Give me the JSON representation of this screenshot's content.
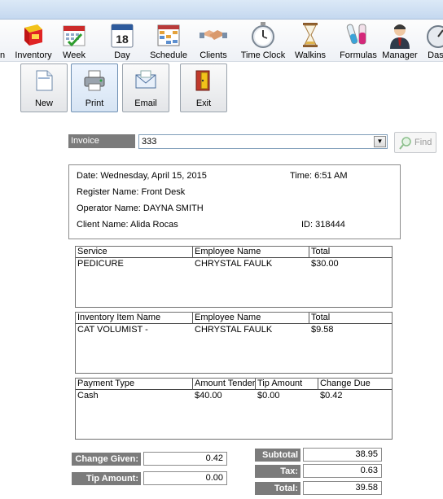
{
  "toolbar": {
    "items": [
      {
        "label": "on",
        "icon": "admin-icon"
      },
      {
        "label": "Inventory",
        "icon": "inventory-box-icon"
      },
      {
        "label": "Week",
        "icon": "week-calendar-icon"
      },
      {
        "label": "Day",
        "icon": "day-calendar-icon"
      },
      {
        "label": "Schedule",
        "icon": "schedule-grid-icon"
      },
      {
        "label": "Clients",
        "icon": "handshake-icon"
      },
      {
        "label": "Time Clock",
        "icon": "stopwatch-icon"
      },
      {
        "label": "Walkins",
        "icon": "hourglass-icon"
      },
      {
        "label": "Formulas",
        "icon": "test-tubes-icon"
      },
      {
        "label": "Manager",
        "icon": "manager-person-icon"
      },
      {
        "label": "Dash",
        "icon": "dashboard-gauge-icon"
      }
    ],
    "day_number": "18"
  },
  "actions": {
    "new": "New",
    "print": "Print",
    "email": "Email",
    "exit": "Exit"
  },
  "invoice": {
    "label": "Invoice Number:",
    "value": "333",
    "find": "Find"
  },
  "info": {
    "date": "Date:  Wednesday, April 15, 2015",
    "time": "Time:  6:51 AM",
    "register": "Register Name:  Front Desk",
    "operator": "Operator Name:  DAYNA SMITH",
    "client": "Client Name:  Alida Rocas",
    "id": "ID:  318444"
  },
  "services": {
    "headers": [
      "Service",
      "Employee Name",
      "Total"
    ],
    "rows": [
      [
        "PEDICURE",
        "CHRYSTAL FAULK",
        "$30.00"
      ]
    ]
  },
  "inventory_items": {
    "headers": [
      "Inventory Item Name",
      "Employee Name",
      "Total"
    ],
    "rows": [
      [
        "CAT VOLUMIST -",
        "CHRYSTAL FAULK",
        "$9.58"
      ]
    ]
  },
  "payments": {
    "headers": [
      "Payment Type",
      "Amount Tender",
      "Tip Amount",
      "Change Due"
    ],
    "rows": [
      [
        "Cash",
        "$40.00",
        "$0.00",
        "$0.42"
      ]
    ]
  },
  "totals": {
    "change_given_label": "Change Given:",
    "change_given": "0.42",
    "tip_amount_label": "Tip Amount:",
    "tip_amount": "0.00",
    "subtotal_label": "Subtotal",
    "subtotal": "38.95",
    "tax_label": "Tax:",
    "tax": "0.63",
    "total_label": "Total:",
    "total": "39.58"
  }
}
